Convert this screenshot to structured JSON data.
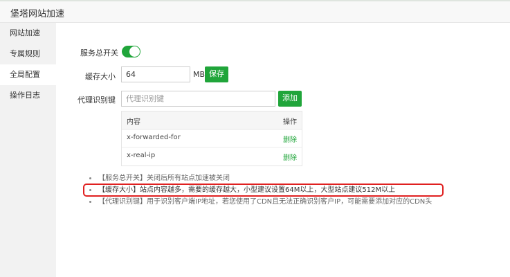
{
  "window": {
    "title": "堡塔网站加速"
  },
  "sidebar": {
    "items": [
      {
        "label": "网站加速"
      },
      {
        "label": "专属规则"
      },
      {
        "label": "全局配置"
      },
      {
        "label": "操作日志"
      }
    ],
    "active_index": 2
  },
  "form": {
    "service_switch": {
      "label": "服务总开关",
      "on": true
    },
    "cache_size": {
      "label": "缓存大小",
      "value": "64",
      "unit": "MB",
      "save_label": "保存"
    },
    "proxy_key": {
      "label": "代理识别键",
      "placeholder": "代理识别键",
      "add_label": "添加"
    }
  },
  "table": {
    "headers": {
      "content": "内容",
      "action": "操作"
    },
    "rows": [
      {
        "content": "x-forwarded-for",
        "action": "删除"
      },
      {
        "content": "x-real-ip",
        "action": "删除"
      }
    ]
  },
  "notes": [
    "【服务总开关】关闭后所有站点加速被关闭",
    "【缓存大小】站点内容越多，需要的缓存越大，小型建议设置64M以上，大型站点建议512M以上",
    "【代理识别键】用于识别客户端IP地址，若您使用了CDN且无法正确识别客户IP，可能需要添加对应的CDN头"
  ],
  "colors": {
    "accent": "#20a53a",
    "highlight_border": "#e02020"
  }
}
